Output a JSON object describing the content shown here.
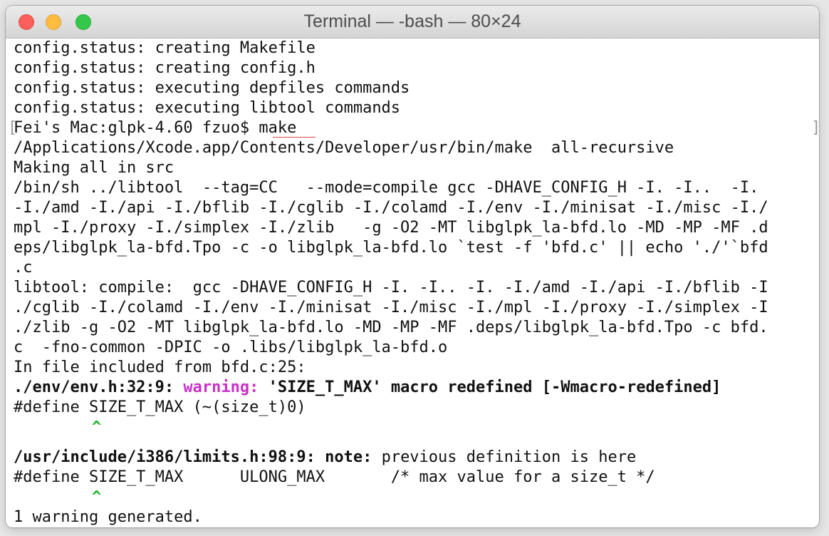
{
  "window": {
    "title": "Terminal — -bash — 80×24"
  },
  "terminal": {
    "lines": [
      "config.status: creating Makefile",
      "config.status: creating config.h",
      "config.status: executing depfiles commands",
      "config.status: executing libtool commands",
      "Fei's Mac:glpk-4.60 fzuo$ make ",
      "/Applications/Xcode.app/Contents/Developer/usr/bin/make  all-recursive",
      "Making all in src",
      "/bin/sh ../libtool  --tag=CC   --mode=compile gcc -DHAVE_CONFIG_H -I. -I..  -I.",
      "-I./amd -I./api -I./bflib -I./cglib -I./colamd -I./env -I./minisat -I./misc -I./",
      "mpl -I./proxy -I./simplex -I./zlib   -g -O2 -MT libglpk_la-bfd.lo -MD -MP -MF .d",
      "eps/libglpk_la-bfd.Tpo -c -o libglpk_la-bfd.lo `test -f 'bfd.c' || echo './'`bfd",
      ".c",
      "libtool: compile:  gcc -DHAVE_CONFIG_H -I. -I.. -I. -I./amd -I./api -I./bflib -I",
      "./cglib -I./colamd -I./env -I./minisat -I./misc -I./mpl -I./proxy -I./simplex -I",
      "./zlib -g -O2 -MT libglpk_la-bfd.lo -MD -MP -MF .deps/libglpk_la-bfd.Tpo -c bfd.",
      "c  -fno-common -DPIC -o .libs/libglpk_la-bfd.o",
      "In file included from bfd.c:25:"
    ],
    "warning_line": {
      "location": "./env/env.h:32:9: ",
      "label": "warning:",
      "message": " 'SIZE_T_MAX' macro redefined [-Wmacro-redefined]"
    },
    "define_line_1": "#define SIZE_T_MAX (~(size_t)0)",
    "caret_1": "^",
    "note_line": {
      "location": "/usr/include/i386/limits.h:98:9: ",
      "label": "note:",
      "message": " previous definition is here"
    },
    "define_line_2": "#define SIZE_T_MAX      ULONG_MAX       /* max value for a size_t */",
    "caret_2": "^",
    "summary": "1 warning generated.",
    "prompt_open_bracket": "[",
    "prompt_close_bracket": "]"
  },
  "colors": {
    "warning": "#c930c7",
    "caret": "#21b82f"
  }
}
